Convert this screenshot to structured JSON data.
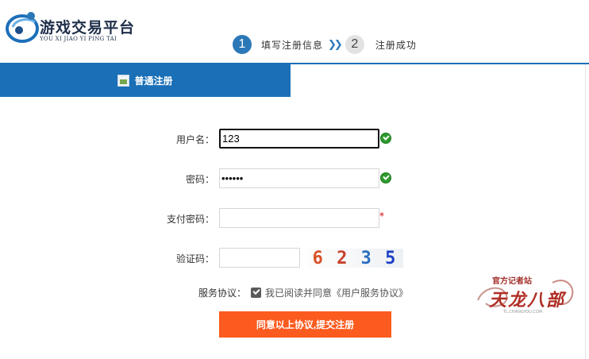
{
  "logo": {
    "title": "游戏交易平台",
    "subtitle": "YOU XI JIAO YI PING TAI"
  },
  "steps": [
    {
      "number": "1",
      "label": "填写注册信息",
      "active": true
    },
    {
      "number": "2",
      "label": "注册成功",
      "active": false
    }
  ],
  "step_separator_icon": "double-chevron-right-icon",
  "tab": {
    "icon": "image-icon",
    "label": "普通注册"
  },
  "form": {
    "username": {
      "label": "用户名：",
      "value": "123",
      "status_icon": "check-circle-icon"
    },
    "password": {
      "label": "密码：",
      "value": "••••••",
      "status_icon": "check-circle-icon"
    },
    "pay_password": {
      "label": "支付密码：",
      "value": "",
      "required_mark": "*"
    },
    "captcha": {
      "label": "验证码：",
      "value": "",
      "code": [
        "6",
        "2",
        "3",
        "5"
      ]
    }
  },
  "agreement": {
    "label": "服务协议：",
    "checked": true,
    "text": "我已阅读并同意《用户服务协议》"
  },
  "submit_label": "同意以上协议,提交注册",
  "watermark": {
    "top": "官方记者站",
    "main": "天龙八部",
    "url": "TL.CHANGYOU.COM"
  },
  "colors": {
    "brand_blue": "#1a6fb7",
    "step_active": "#2b78b8",
    "submit_orange": "#fb5b1e",
    "success_green": "#2e9a2e",
    "required_red": "#d40000"
  }
}
